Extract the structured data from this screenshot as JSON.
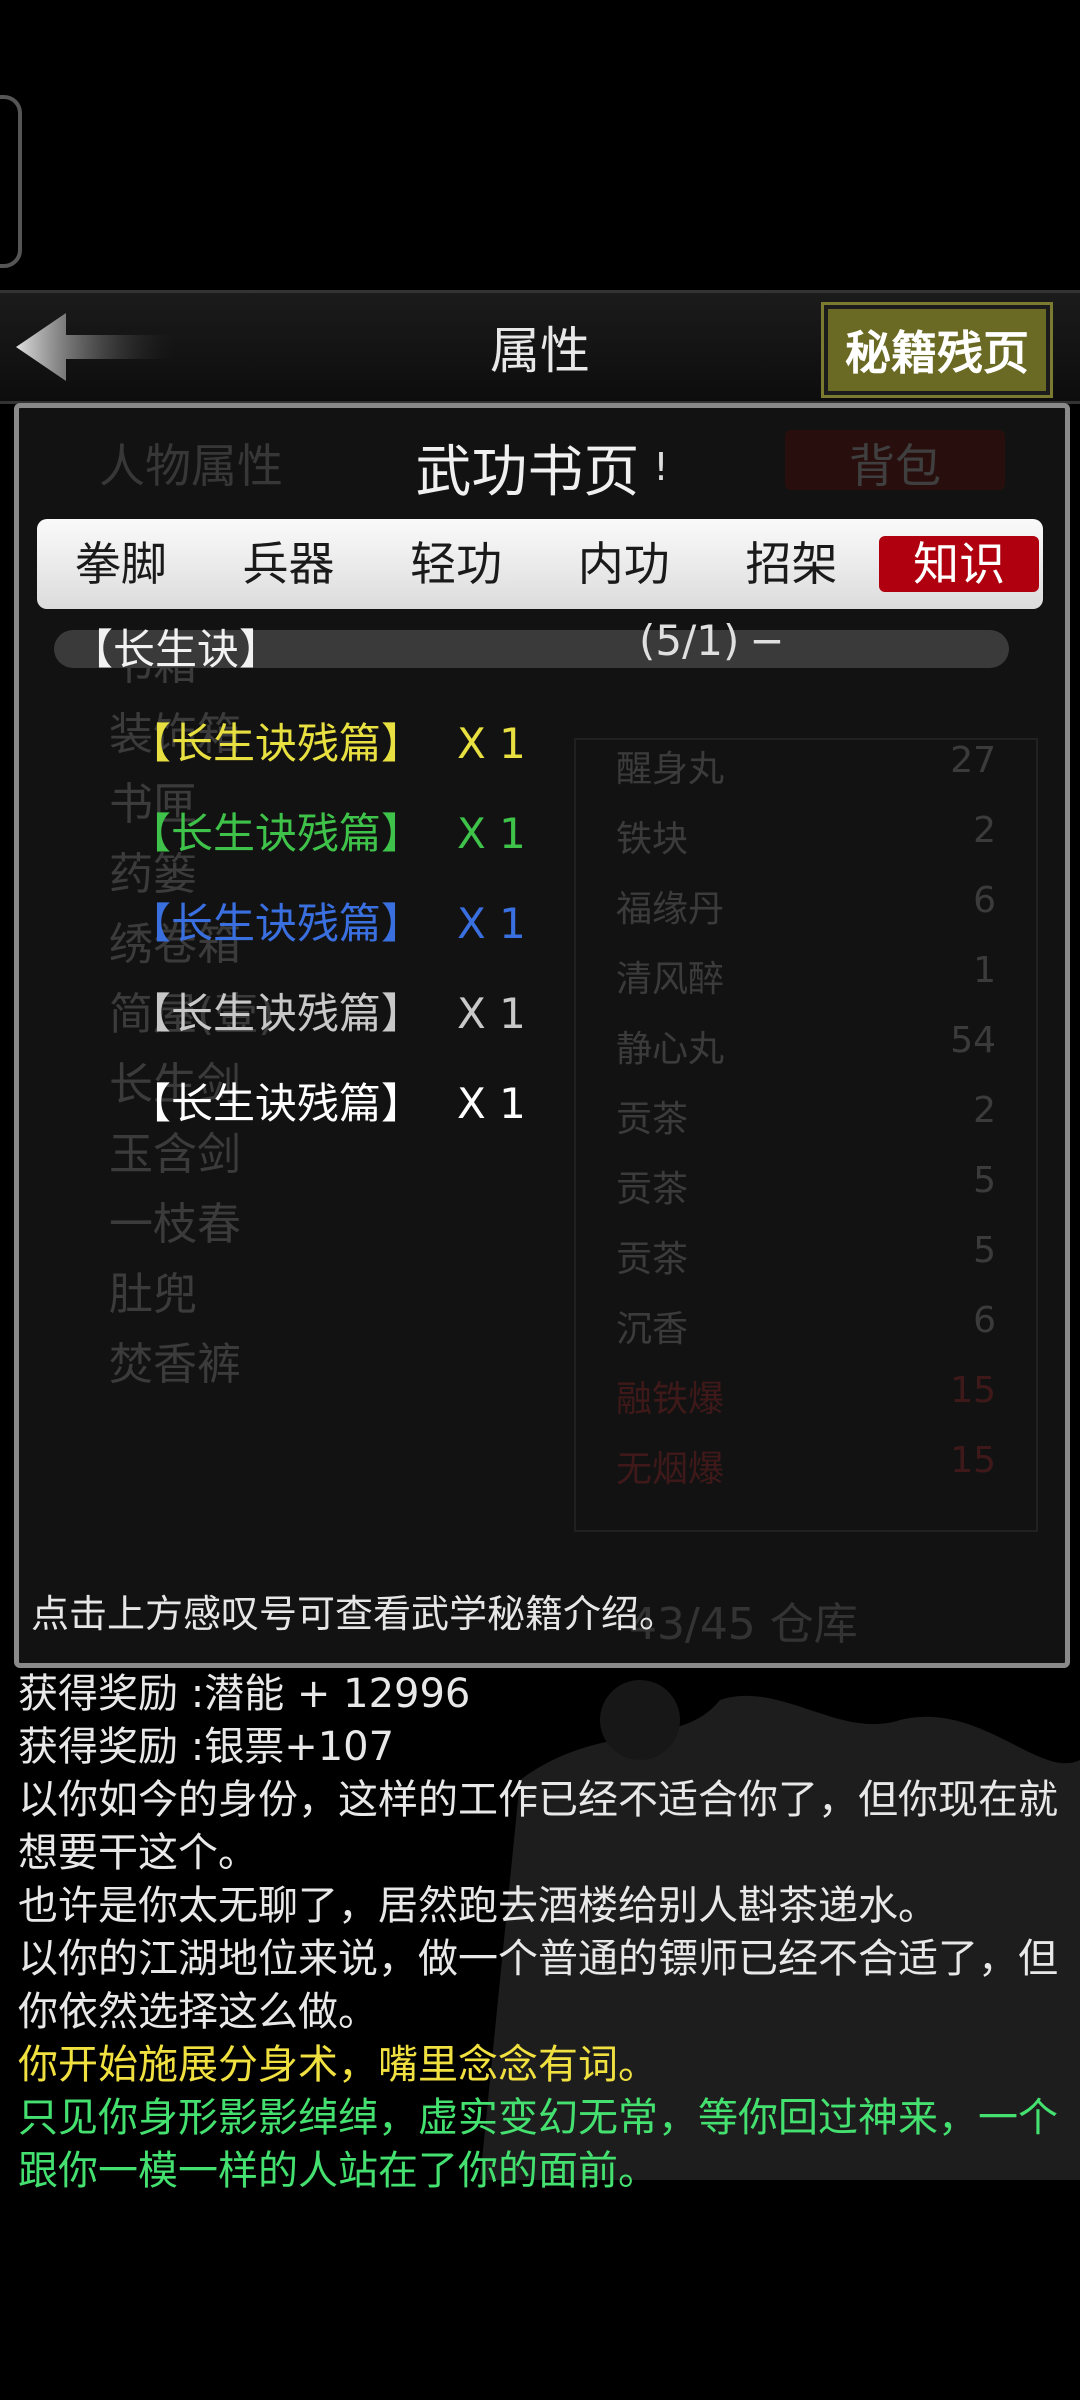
{
  "header": {
    "title": "属性",
    "right_button": "秘籍残页"
  },
  "background_inventory": {
    "left_tab": "人物属性",
    "right_tab": "背包",
    "items": [
      "书箱",
      "装饰箱",
      "书匣",
      "药篓",
      "绣卷箱",
      "简屋(壹)",
      "长生剑",
      "玉含剑",
      "一枝春",
      "肚兜",
      "焚香裤"
    ],
    "right_items": [
      {
        "name": "醒身丸",
        "count": "27"
      },
      {
        "name": "铁块",
        "count": "2"
      },
      {
        "name": "福缘丹",
        "count": "6"
      },
      {
        "name": "清风醉",
        "count": "1"
      },
      {
        "name": "静心丸",
        "count": "54"
      },
      {
        "name": "贡茶",
        "count": "2"
      },
      {
        "name": "贡茶",
        "count": "5"
      },
      {
        "name": "贡茶",
        "count": "5"
      },
      {
        "name": "沉香",
        "count": "6"
      },
      {
        "name": "融铁爆",
        "count": "15"
      },
      {
        "name": "无烟爆",
        "count": "15"
      }
    ],
    "footer": "43/45 仓库"
  },
  "book": {
    "title": "武功书页",
    "exclaim": "!",
    "tabs": [
      "拳脚",
      "兵器",
      "轻功",
      "内功",
      "招架",
      "知识"
    ],
    "active_tab": "知识",
    "skill": {
      "name": "【长生诀】",
      "count": "(5/1)",
      "toggle": "−"
    },
    "fragments": [
      {
        "name": "【长生诀残篇】",
        "qty": "X 1",
        "color": "#e8e040"
      },
      {
        "name": "【长生诀残篇】",
        "qty": "X 1",
        "color": "#3fc24a"
      },
      {
        "name": "【长生诀残篇】",
        "qty": "X 1",
        "color": "#3a6fe0"
      },
      {
        "name": "【长生诀残篇】",
        "qty": "X 1",
        "color": "#c8c8c8"
      },
      {
        "name": "【长生诀残篇】",
        "qty": "X 1",
        "color": "#ffffff"
      }
    ],
    "hint": "点击上方感叹号可查看武学秘籍介绍。"
  },
  "log": [
    {
      "text": "获得奖励 :潜能 + 12996",
      "color": "white"
    },
    {
      "text": "获得奖励 :银票+107",
      "color": "white"
    },
    {
      "text": "以你如今的身份，这样的工作已经不适合你了，但你现在就想要干这个。",
      "color": "white"
    },
    {
      "text": "也许是你太无聊了，居然跑去酒楼给别人斟茶递水。",
      "color": "white"
    },
    {
      "text": "以你的江湖地位来说，做一个普通的镖师已经不合适了，但你依然选择这么做。",
      "color": "white"
    },
    {
      "text": "你开始施展分身术，嘴里念念有词。",
      "color": "yellow"
    },
    {
      "text": "只见你身形影影绰绰，虚实变幻无常，等你回过神来，一个跟你一模一样的人站在了你的面前。",
      "color": "green"
    }
  ]
}
